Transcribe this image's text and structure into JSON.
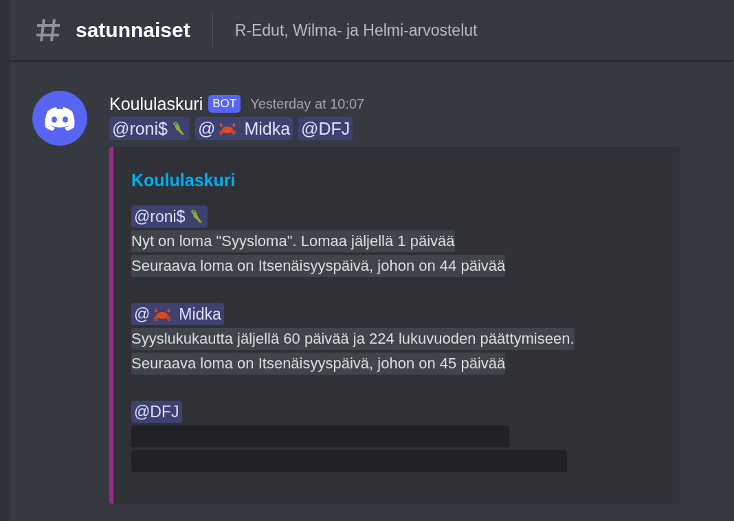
{
  "channel": {
    "name": "satunnaiset",
    "topic": "R-Edut, Wilma- ja Helmi-arvostelut"
  },
  "message": {
    "author": "Koululaskuri",
    "badge": "BOT",
    "timestamp": "Yesterday at 10:07",
    "mentions": [
      {
        "parts": [
          {
            "kind": "text",
            "text": "@roni$"
          },
          {
            "kind": "parrot-emoji"
          }
        ]
      },
      {
        "parts": [
          {
            "kind": "text",
            "text": "@"
          },
          {
            "kind": "crab-emoji"
          },
          {
            "kind": "text",
            "text": "Midka"
          }
        ]
      },
      {
        "parts": [
          {
            "kind": "text",
            "text": "@DFJ"
          }
        ]
      }
    ],
    "embed": {
      "title": "Koululaskuri",
      "sections": [
        {
          "mention": {
            "parts": [
              {
                "kind": "text",
                "text": "@roni$"
              },
              {
                "kind": "parrot-emoji"
              }
            ]
          },
          "lines": [
            {
              "kind": "text",
              "text": "Nyt on loma \"Syysloma\". Lomaa jäljellä 1 päivää"
            },
            {
              "kind": "text",
              "text": "Seuraava loma on Itsenäisyyspäivä, johon on 44 päivää"
            }
          ]
        },
        {
          "mention": {
            "parts": [
              {
                "kind": "text",
                "text": "@"
              },
              {
                "kind": "crab-emoji"
              },
              {
                "kind": "text",
                "text": "Midka"
              }
            ]
          },
          "lines": [
            {
              "kind": "text",
              "text": "Syyslukukautta jäljellä 60 päivää ja 224 lukuvuoden päättymiseen."
            },
            {
              "kind": "text",
              "text": "Seuraava loma on Itsenäisyyspäivä, johon on 45 päivää"
            }
          ]
        },
        {
          "mention": {
            "parts": [
              {
                "kind": "text",
                "text": "@DFJ"
              }
            ]
          },
          "lines": [
            {
              "kind": "spoiler"
            },
            {
              "kind": "spoiler"
            }
          ]
        }
      ]
    }
  }
}
